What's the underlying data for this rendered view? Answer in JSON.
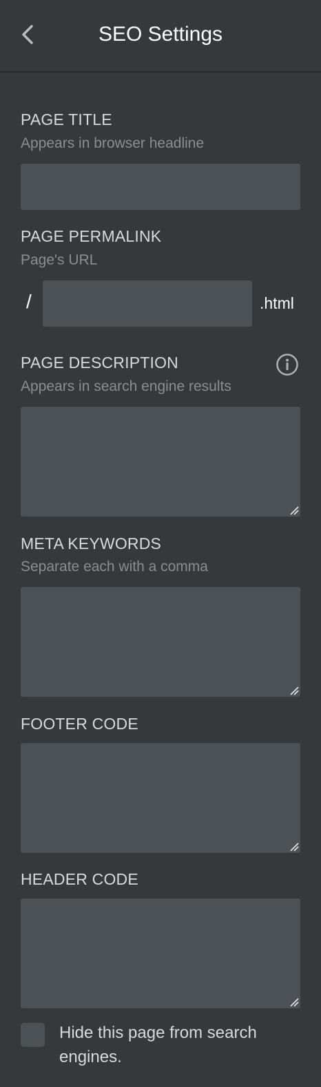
{
  "header": {
    "title": "SEO Settings",
    "back_icon": "chevron-left-icon"
  },
  "page_title": {
    "label": "PAGE TITLE",
    "hint": "Appears in browser headline",
    "value": ""
  },
  "page_permalink": {
    "label": "PAGE PERMALINK",
    "hint": "Page's URL",
    "prefix": "/",
    "suffix": ".html",
    "value": ""
  },
  "page_description": {
    "label": "PAGE DESCRIPTION",
    "hint": "Appears in search engine results",
    "info_icon": "info-icon",
    "value": ""
  },
  "meta_keywords": {
    "label": "META KEYWORDS",
    "hint": "Separate each with a comma",
    "value": ""
  },
  "footer_code": {
    "label": "FOOTER CODE",
    "value": ""
  },
  "header_code": {
    "label": "HEADER CODE",
    "value": ""
  },
  "hide_from_search": {
    "label": "Hide this page from search engines.",
    "checked": false
  },
  "colors": {
    "background": "#35393c",
    "field": "#4c5155",
    "label": "#d8dadc",
    "hint": "#898e93",
    "title": "#ffffff"
  }
}
